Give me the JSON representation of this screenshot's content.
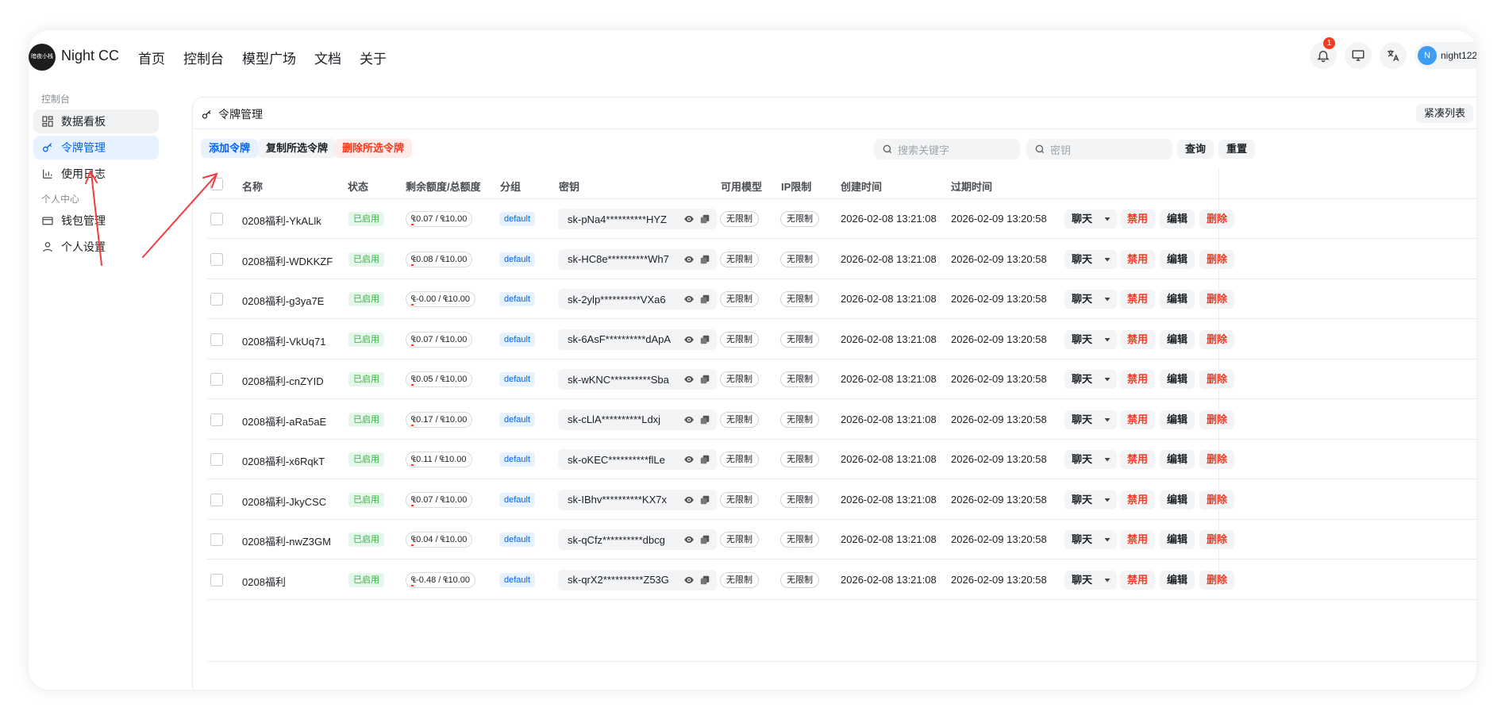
{
  "app": {
    "logo_text": "暗夜小栈",
    "brand": "Night CC"
  },
  "nav": {
    "items": [
      "首页",
      "控制台",
      "模型广场",
      "文档",
      "关于"
    ]
  },
  "header": {
    "notification_count": "1",
    "avatar_letter": "N",
    "username": "night122"
  },
  "sidebar": {
    "group1": "控制台",
    "items1": [
      "数据看板",
      "令牌管理",
      "使用日志"
    ],
    "group2": "个人中心",
    "items2": [
      "钱包管理",
      "个人设置"
    ]
  },
  "page": {
    "title": "令牌管理",
    "compact_label": "紧凑列表",
    "add_label": "添加令牌",
    "copy_label": "复制所选令牌",
    "delete_label": "删除所选令牌",
    "search_placeholder": "搜索关键字",
    "key_placeholder": "密钥",
    "query_label": "查询",
    "reset_label": "重置"
  },
  "table": {
    "columns": [
      "名称",
      "状态",
      "剩余额度/总额度",
      "分组",
      "密钥",
      "可用模型",
      "IP限制",
      "创建时间",
      "过期时间"
    ],
    "actions": {
      "chat": "聊天",
      "disable": "禁用",
      "edit": "编辑",
      "delete": "删除"
    },
    "rows": [
      {
        "name": "0208福利-YkALlk",
        "status": "已启用",
        "quota": "₠0.07 / ₠10.00",
        "group": "default",
        "key": "sk-pNa4**********HYZ",
        "models": "无限制",
        "ip": "无限制",
        "created": "2026-02-08 13:21:08",
        "expires": "2026-02-09 13:20:58"
      },
      {
        "name": "0208福利-WDKKZF",
        "status": "已启用",
        "quota": "₠0.08 / ₠10.00",
        "group": "default",
        "key": "sk-HC8e**********Wh7",
        "models": "无限制",
        "ip": "无限制",
        "created": "2026-02-08 13:21:08",
        "expires": "2026-02-09 13:20:58"
      },
      {
        "name": "0208福利-g3ya7E",
        "status": "已启用",
        "quota": "₠-0.00 / ₠10.00",
        "group": "default",
        "key": "sk-2ylp**********VXa6",
        "models": "无限制",
        "ip": "无限制",
        "created": "2026-02-08 13:21:08",
        "expires": "2026-02-09 13:20:58"
      },
      {
        "name": "0208福利-VkUq71",
        "status": "已启用",
        "quota": "₠0.07 / ₠10.00",
        "group": "default",
        "key": "sk-6AsF**********dApA",
        "models": "无限制",
        "ip": "无限制",
        "created": "2026-02-08 13:21:08",
        "expires": "2026-02-09 13:20:58"
      },
      {
        "name": "0208福利-cnZYID",
        "status": "已启用",
        "quota": "₠0.05 / ₠10.00",
        "group": "default",
        "key": "sk-wKNC**********Sba",
        "models": "无限制",
        "ip": "无限制",
        "created": "2026-02-08 13:21:08",
        "expires": "2026-02-09 13:20:58"
      },
      {
        "name": "0208福利-aRa5aE",
        "status": "已启用",
        "quota": "₠0.17 / ₠10.00",
        "group": "default",
        "key": "sk-cLlA**********Ldxj",
        "models": "无限制",
        "ip": "无限制",
        "created": "2026-02-08 13:21:08",
        "expires": "2026-02-09 13:20:58"
      },
      {
        "name": "0208福利-x6RqkT",
        "status": "已启用",
        "quota": "₠0.11 / ₠10.00",
        "group": "default",
        "key": "sk-oKEC**********flLe",
        "models": "无限制",
        "ip": "无限制",
        "created": "2026-02-08 13:21:08",
        "expires": "2026-02-09 13:20:58"
      },
      {
        "name": "0208福利-JkyCSC",
        "status": "已启用",
        "quota": "₠0.07 / ₠10.00",
        "group": "default",
        "key": "sk-IBhv**********KX7x",
        "models": "无限制",
        "ip": "无限制",
        "created": "2026-02-08 13:21:08",
        "expires": "2026-02-09 13:20:58"
      },
      {
        "name": "0208福利-nwZ3GM",
        "status": "已启用",
        "quota": "₠0.04 / ₠10.00",
        "group": "default",
        "key": "sk-qCfz**********dbcg",
        "models": "无限制",
        "ip": "无限制",
        "created": "2026-02-08 13:21:08",
        "expires": "2026-02-09 13:20:58"
      },
      {
        "name": "0208福利",
        "status": "已启用",
        "quota": "₠-0.48 / ₠10.00",
        "group": "default",
        "key": "sk-qrX2**********Z53G",
        "models": "无限制",
        "ip": "无限制",
        "created": "2026-02-08 13:21:08",
        "expires": "2026-02-09 13:20:58"
      }
    ]
  },
  "colors": {
    "accent": "#0064fa",
    "danger": "#f93920",
    "success": "#3bb346",
    "annotation": "#f03c3c"
  }
}
